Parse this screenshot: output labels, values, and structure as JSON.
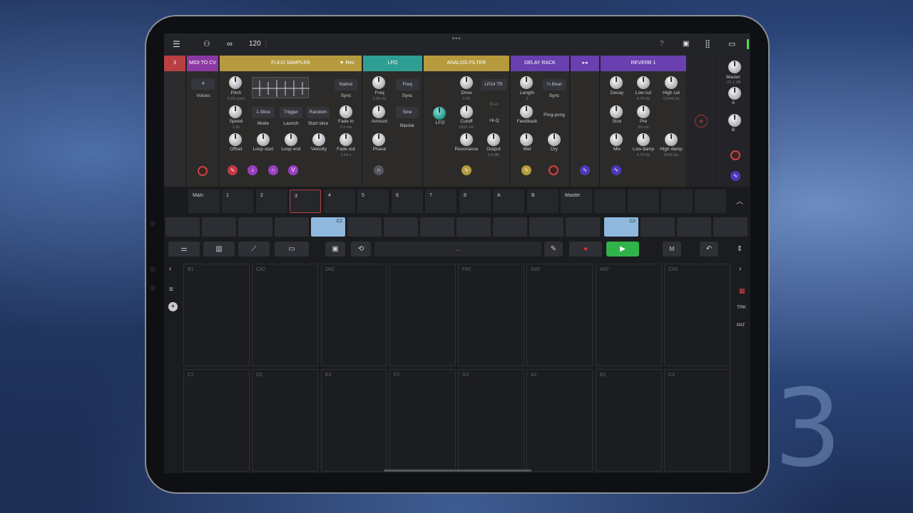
{
  "topbar": {
    "tempo": "120",
    "menu_icon": "menu-icon",
    "metronome_icon": "metronome-icon",
    "loop_icon": "loop-icon",
    "help": "?"
  },
  "devices": {
    "track_num": "3",
    "midi_to_cv": {
      "title": "MIDI TO CV",
      "voices_value": "4",
      "voices_label": "Voices"
    },
    "flexi": {
      "title": "FLEXI SAMPLER",
      "rec": "▼ Rec",
      "pitch": "Pitch",
      "pitch_val": "0.00 semi",
      "native": "Native",
      "sync": "Sync",
      "speed": "Speed",
      "speed_val": "1.00",
      "mode_val": "1-Slice",
      "mode": "Mode",
      "launch_val": "Trigger",
      "launch": "Launch",
      "start_slice_val": "Random",
      "start_slice": "Start slice",
      "fade_in": "Fade in",
      "fade_in_val": "0.5 ms",
      "offset": "Offset",
      "loop_start": "Loop start",
      "loop_end": "Loop end",
      "velocity": "Velocity",
      "fade_out": "Fade out",
      "fade_out_val": "2.64 s"
    },
    "lfo": {
      "title": "LFO",
      "freq": "Freq",
      "freq_val": "0.05 Hz",
      "freq_mode": "Freq",
      "sync": "Sync",
      "amount": "Amount",
      "wave": "Sine",
      "bipolar": "Bipolar",
      "phase": "Phase"
    },
    "filter": {
      "title": "ANALOG FILTER",
      "drive": "Drive",
      "drive_val": "0.00",
      "type": "LP24 TR",
      "bias": "Bias",
      "lfo": "LFO",
      "cutoff": "Cutoff",
      "cutoff_val": "5321 Hz",
      "hiq": "Hi-Q",
      "resonance": "Resonance",
      "output": "Output",
      "output_val": "0.0 dB"
    },
    "delay": {
      "title": "DELAY RACK",
      "length": "Length",
      "length_val": "3",
      "beat": "¼ Beat",
      "sync": "Sync",
      "feedback": "Feedback",
      "pingpong": "Ping-pong",
      "wet": "Wet",
      "dry": "Dry"
    },
    "reverb": {
      "title": "REVERB 1",
      "decay": "Decay",
      "lowcut": "Low cut",
      "lowcut_val": "4.70 Hz",
      "highcut": "High cut",
      "highcut_val": "21046 Hz",
      "size": "Size",
      "pre": "Pre",
      "pre_val": "50 ms",
      "mix": "Mix",
      "lowdamp": "Low damp",
      "lowdamp_val": "4.70 Hz",
      "highdamp": "High damp",
      "highdamp_val": "6344 Hz"
    },
    "master": {
      "label": "Master",
      "val": "-21.1 dB",
      "a": "A",
      "b": "B"
    }
  },
  "tracks": [
    "Main",
    "1",
    "2",
    "3",
    "4",
    "5",
    "6",
    "7",
    "8",
    "A",
    "B",
    "Master"
  ],
  "clips": {
    "clip1": "C2",
    "clip2": "C2"
  },
  "transport": {
    "position": "..."
  },
  "pads_top": [
    "B1",
    "C#2",
    "D#2",
    "",
    "F#2",
    "G#2",
    "A#2",
    "C#3"
  ],
  "pads_bottom": [
    "C2",
    "D2",
    "E2",
    "F2",
    "G2",
    "A2",
    "B2",
    "C3"
  ],
  "side": {
    "trk": "TRK",
    "pat": "PAT"
  },
  "colors": {
    "flexi": "#b59a3f",
    "lfo": "#2f9e92",
    "filter": "#b69a3e",
    "delay": "#6a3fb0",
    "reverb": "#6a3fb0",
    "midi": "#8c3aa3",
    "track": "#b84043",
    "play": "#2fb34a"
  }
}
